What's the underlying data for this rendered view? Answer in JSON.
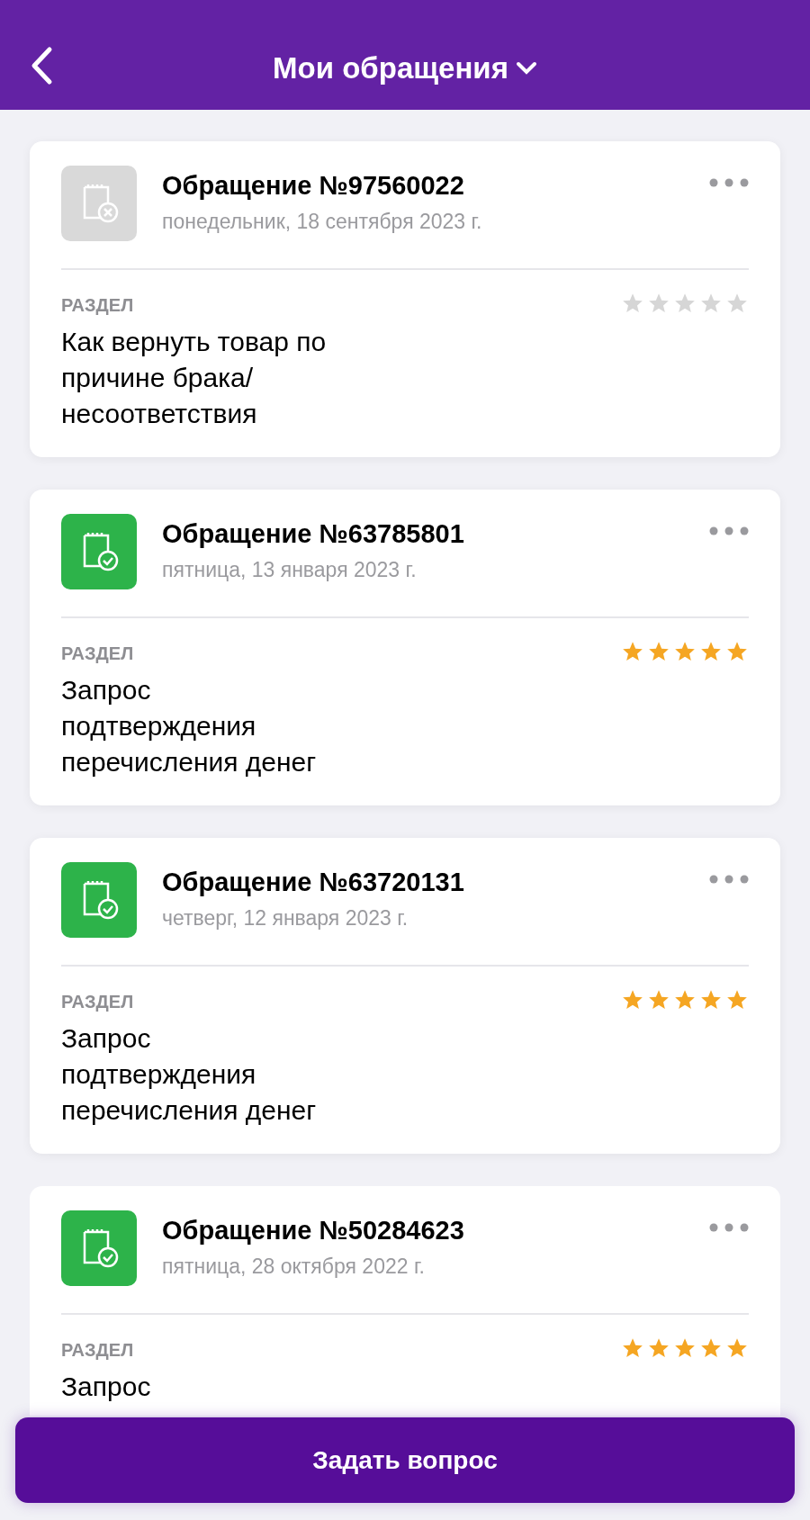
{
  "header": {
    "title": "Мои обращения"
  },
  "tickets": [
    {
      "kind": "closed",
      "title": "Обращение №97560022",
      "date": "понедельник, 18 сентября 2023 г.",
      "section_label": "РАЗДЕЛ",
      "section": "Как вернуть товар по причине брака/ несоответствия",
      "stars": 0
    },
    {
      "kind": "resolved",
      "title": "Обращение №63785801",
      "date": "пятница, 13 января 2023 г.",
      "section_label": "РАЗДЕЛ",
      "section": "Запрос подтверждения перечисления денег",
      "stars": 5
    },
    {
      "kind": "resolved",
      "title": "Обращение №63720131",
      "date": "четверг, 12 января 2023 г.",
      "section_label": "РАЗДЕЛ",
      "section": "Запрос подтверждения перечисления денег",
      "stars": 5
    },
    {
      "kind": "resolved",
      "title": "Обращение №50284623",
      "date": "пятница, 28 октября 2022 г.",
      "section_label": "РАЗДЕЛ",
      "section": "Запрос",
      "stars": 5
    }
  ],
  "ask_button": "Задать вопрос"
}
